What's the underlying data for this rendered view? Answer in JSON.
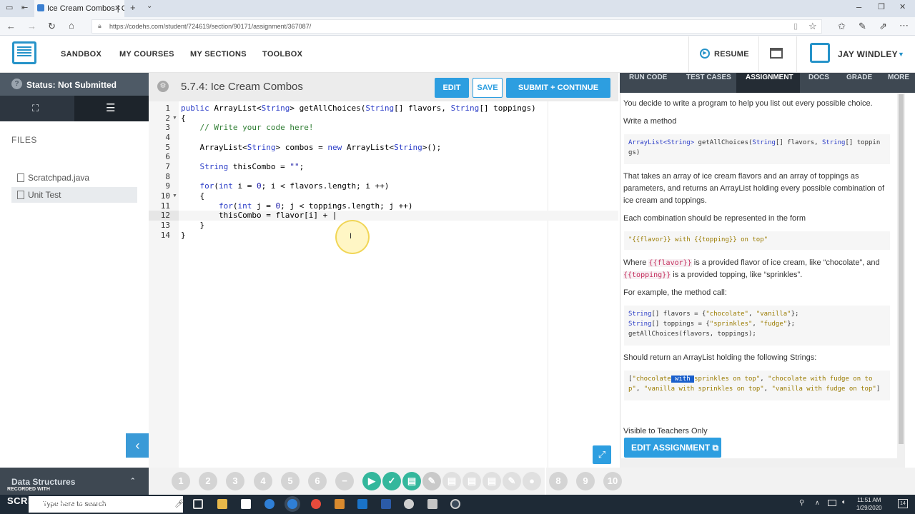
{
  "browser": {
    "tab_title": "Ice Cream Combos | Co",
    "url": "https://codehs.com/student/724619/section/90171/assignment/367087/"
  },
  "header": {
    "nav": [
      "SANDBOX",
      "MY COURSES",
      "MY SECTIONS",
      "TOOLBOX"
    ],
    "resume": "RESUME",
    "user": "JAY WINDLEY"
  },
  "sidebar": {
    "status": "Status: Not Submitted",
    "files_label": "FILES",
    "files": [
      "Scratchpad.java",
      "Unit Test"
    ],
    "bottom": "Data Structures"
  },
  "editor": {
    "title": "5.7.4: Ice Cream Combos",
    "edit": "EDIT",
    "save": "SAVE",
    "submit": "SUBMIT + CONTINUE",
    "line_numbers": [
      "1",
      "2",
      "3",
      "4",
      "5",
      "6",
      "7",
      "8",
      "9",
      "10",
      "11",
      "12",
      "13",
      "14"
    ]
  },
  "right_panel": {
    "tabs": [
      "RUN CODE",
      "TEST CASES",
      "ASSIGNMENT",
      "DOCS",
      "GRADE",
      "MORE"
    ],
    "p1": "You decide to write a program to help you list out every possible choice.",
    "p2": "Write a method",
    "p3": "That takes an array of ice cream flavors and an array of toppings as parameters, and returns an ArrayList holding every possible combination of ice cream and toppings.",
    "p4": "Each combination should be represented in the form",
    "p5_where": "Where",
    "p5_flavor": "{{flavor}}",
    "p5_mid": "is a provided flavor of ice cream, like “chocolate”, and",
    "p5_topping": "{{topping}}",
    "p5_end": "is a provided topping, like “sprinkles”.",
    "p6": "For example, the method call:",
    "p7": "Should return an ArrayList holding the following Strings:",
    "visible": "Visible to Teachers Only",
    "edit_assignment": "EDIT ASSIGNMENT"
  },
  "dots": [
    "1",
    "2",
    "3",
    "4",
    "5",
    "6",
    "8",
    "9",
    "10"
  ],
  "taskbar": {
    "search_placeholder": "Type here to search",
    "time": "11:51 AM",
    "date": "1/29/2020"
  },
  "watermark": {
    "line1": "RECORDED WITH",
    "line2": "SCREENCAST-O-MATIC"
  },
  "colors": {
    "accent": "#2d9ee0",
    "sidebar_dark": "#2d3640",
    "status_bar": "#4e5a66",
    "green": "#34b79c"
  }
}
